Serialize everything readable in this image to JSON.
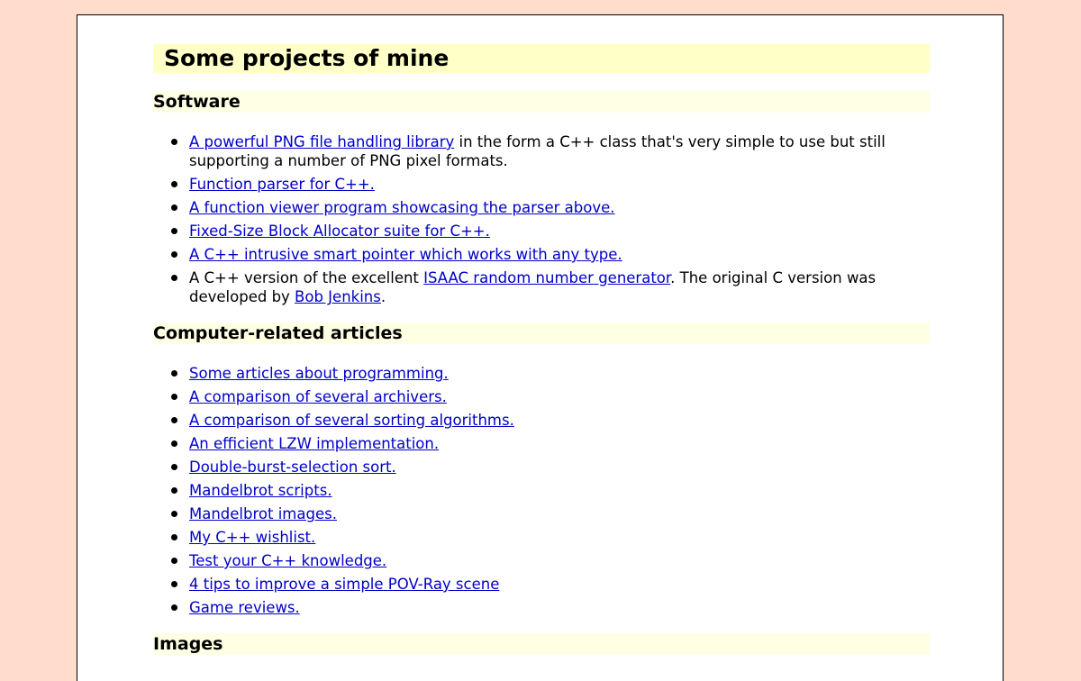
{
  "title": "Some projects of mine",
  "software": {
    "heading": "Software",
    "png": {
      "link": "A powerful PNG file handling library",
      "rest": " in the form a C++ class that's very simple to use but still supporting a number of PNG pixel formats."
    },
    "items": [
      "Function parser for C++.",
      "A function viewer program showcasing the parser above.",
      "Fixed-Size Block Allocator suite for C++.",
      "A C++ intrusive smart pointer which works with any type."
    ],
    "isaac": {
      "pre": "A C++ version of the excellent ",
      "link1": "ISAAC random number generator",
      "mid": ". The original C version was developed by ",
      "link2": "Bob Jenkins",
      "post": "."
    }
  },
  "articles": {
    "heading": "Computer-related articles",
    "items": [
      "Some articles about programming.",
      "A comparison of several archivers.",
      "A comparison of several sorting algorithms.",
      "An efficient LZW implementation.",
      "Double-burst-selection sort.",
      "Mandelbrot scripts.",
      "Mandelbrot images.",
      "My C++ wishlist.",
      "Test your C++ knowledge.",
      "4 tips to improve a simple POV-Ray scene",
      "Game reviews."
    ]
  },
  "images": {
    "heading": "Images"
  },
  "colors": {
    "background": "#ffdccb",
    "title_bg": "#ffffc8",
    "heading_bg": "#ffffe4",
    "link": "#0000c8"
  }
}
